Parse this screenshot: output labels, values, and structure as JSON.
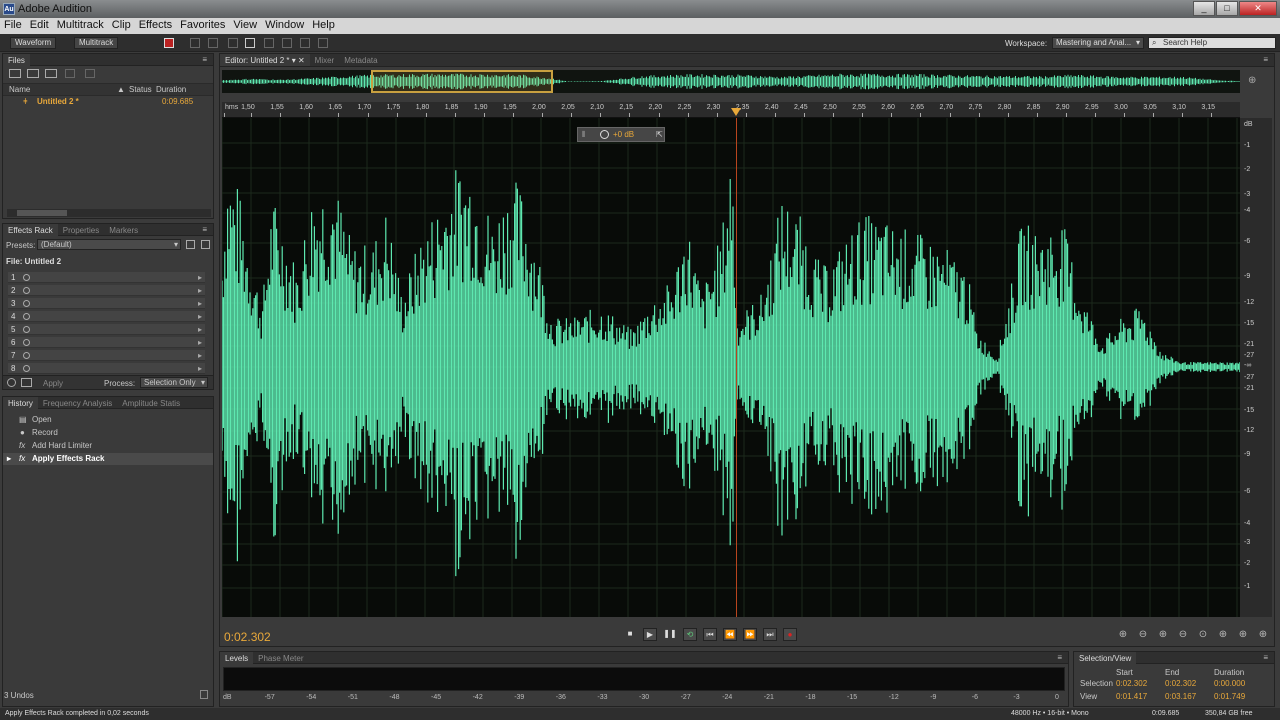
{
  "window": {
    "title": "Adobe Audition",
    "logo": "Au"
  },
  "menu": [
    "File",
    "Edit",
    "Multitrack",
    "Clip",
    "Effects",
    "Favorites",
    "View",
    "Window",
    "Help"
  ],
  "toolbar": {
    "waveform": "Waveform",
    "multitrack": "Multitrack",
    "workspace_label": "Workspace:",
    "workspace_value": "Mastering and Anal...",
    "search_placeholder": "Search Help"
  },
  "files": {
    "tab": "Files",
    "col_name": "Name",
    "col_status": "Status",
    "col_duration": "Duration",
    "file_name": "Untitled 2 *",
    "file_duration": "0:09.685"
  },
  "effects": {
    "tabs": [
      "Effects Rack",
      "Properties",
      "Markers"
    ],
    "presets_label": "Presets:",
    "presets_value": "(Default)",
    "file_label": "File: Untitled 2",
    "slots": [
      "1",
      "2",
      "3",
      "4",
      "5",
      "6",
      "7",
      "8"
    ],
    "apply": "Apply",
    "process_label": "Process:",
    "process_value": "Selection Only"
  },
  "history": {
    "tabs": [
      "History",
      "Frequency Analysis",
      "Amplitude Statis"
    ],
    "items": [
      "Open",
      "Record",
      "Add Hard Limiter",
      "Apply Effects Rack"
    ],
    "undos": "3 Undos"
  },
  "editor": {
    "tabs": [
      "Editor: Untitled 2 *",
      "Mixer",
      "Metadata"
    ],
    "hud": "+0 dB",
    "timecode": "0:02.302",
    "waveform_color": "#5ee8b0"
  },
  "ruler": [
    "hms",
    "1,50",
    "1,55",
    "1,60",
    "1,65",
    "1,70",
    "1,75",
    "1,80",
    "1,85",
    "1,90",
    "1,95",
    "2,00",
    "2,05",
    "2,10",
    "2,15",
    "2,20",
    "2,25",
    "2,30",
    "2,35",
    "2,40",
    "2,45",
    "2,50",
    "2,55",
    "2,60",
    "2,65",
    "2,70",
    "2,75",
    "2,80",
    "2,85",
    "2,90",
    "2,95",
    "3,00",
    "3,05",
    "3,10",
    "3,15"
  ],
  "db_scale": [
    "dB",
    "-1",
    "-2",
    "-3",
    "-4",
    "-6",
    "-9",
    "-12",
    "-15",
    "-21",
    "-27",
    "-∞",
    "-27",
    "-21",
    "-15",
    "-12",
    "-9",
    "-6",
    "-4",
    "-3",
    "-2",
    "-1"
  ],
  "levels": {
    "tabs": [
      "Levels",
      "Phase Meter"
    ],
    "scale": [
      "dB",
      "-57",
      "-54",
      "-51",
      "-48",
      "-45",
      "-42",
      "-39",
      "-36",
      "-33",
      "-30",
      "-27",
      "-24",
      "-21",
      "-18",
      "-15",
      "-12",
      "-9",
      "-6",
      "-3",
      "0"
    ]
  },
  "selection_view": {
    "tab": "Selection/View",
    "headers": [
      "Start",
      "End",
      "Duration"
    ],
    "selection_label": "Selection",
    "view_label": "View",
    "selection": [
      "0:02.302",
      "0:02.302",
      "0:00.000"
    ],
    "view": [
      "0:01.417",
      "0:03.167",
      "0:01.749"
    ]
  },
  "status": {
    "message": "Apply Effects Rack completed in 0,02 seconds",
    "format": "48000 Hz • 16-bit • Mono",
    "size": "0:09.685",
    "free": "350,84 GB free"
  }
}
